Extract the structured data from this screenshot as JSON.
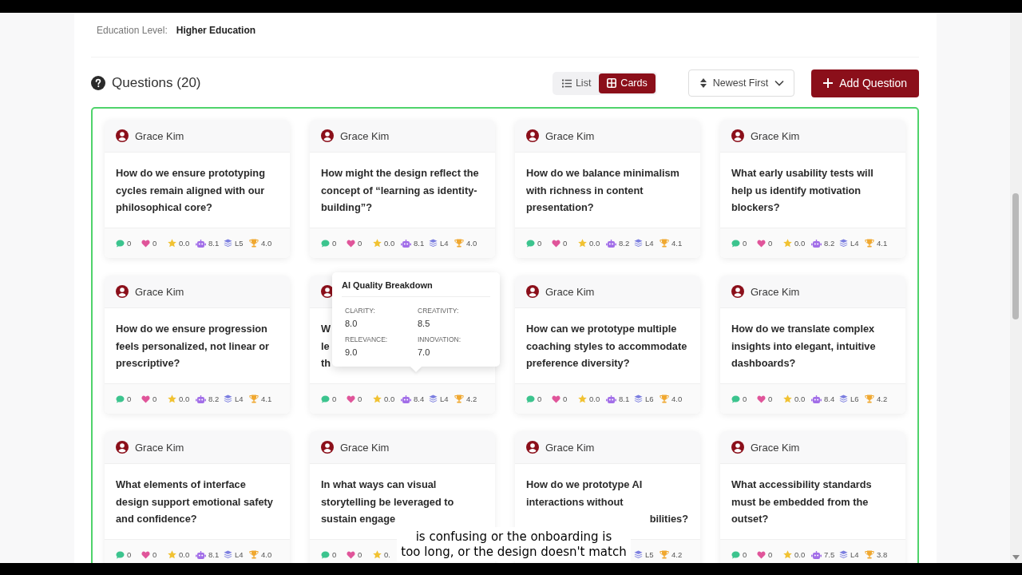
{
  "education": {
    "label": "Education Level:",
    "value": "Higher Education"
  },
  "questions_header": {
    "title": "Questions (20)"
  },
  "view_toggle": [
    {
      "kind": "list",
      "label": "List",
      "selected": false
    },
    {
      "kind": "cards",
      "label": "Cards",
      "selected": true
    }
  ],
  "sort": {
    "label": "Newest First"
  },
  "add_button": {
    "label": "Add Question"
  },
  "cards": [
    {
      "author": "Grace Kim",
      "question": "How do we ensure prototyping cycles remain aligned with our philosophical core?",
      "stats": [
        {
          "kind": "comments",
          "value": "0"
        },
        {
          "kind": "likes",
          "value": "0"
        },
        {
          "kind": "rating",
          "value": "0.0"
        },
        {
          "kind": "ai",
          "value": "8.1"
        },
        {
          "kind": "level",
          "value": "L5"
        },
        {
          "kind": "score",
          "value": "4.0"
        }
      ]
    },
    {
      "author": "Grace Kim",
      "question": "How might the design reflect the concept of “learning as identity-building”?",
      "stats": [
        {
          "kind": "comments",
          "value": "0"
        },
        {
          "kind": "likes",
          "value": "0"
        },
        {
          "kind": "rating",
          "value": "0.0"
        },
        {
          "kind": "ai",
          "value": "8.1"
        },
        {
          "kind": "level",
          "value": "L4"
        },
        {
          "kind": "score",
          "value": "4.0"
        }
      ]
    },
    {
      "author": "Grace Kim",
      "question": "How do we balance minimalism with richness in content presentation?",
      "stats": [
        {
          "kind": "comments",
          "value": "0"
        },
        {
          "kind": "likes",
          "value": "0"
        },
        {
          "kind": "rating",
          "value": "0.0"
        },
        {
          "kind": "ai",
          "value": "8.2"
        },
        {
          "kind": "level",
          "value": "L4"
        },
        {
          "kind": "score",
          "value": "4.1"
        }
      ]
    },
    {
      "author": "Grace Kim",
      "question": "What early usability tests will help us identify motivation blockers?",
      "stats": [
        {
          "kind": "comments",
          "value": "0"
        },
        {
          "kind": "likes",
          "value": "0"
        },
        {
          "kind": "rating",
          "value": "0.0"
        },
        {
          "kind": "ai",
          "value": "8.2"
        },
        {
          "kind": "level",
          "value": "L4"
        },
        {
          "kind": "score",
          "value": "4.1"
        }
      ]
    },
    {
      "author": "Grace Kim",
      "question": "How do we ensure progression feels personalized, not linear or prescriptive?",
      "stats": [
        {
          "kind": "comments",
          "value": "0"
        },
        {
          "kind": "likes",
          "value": "0"
        },
        {
          "kind": "rating",
          "value": "0.0"
        },
        {
          "kind": "ai",
          "value": "8.2"
        },
        {
          "kind": "level",
          "value": "L4"
        },
        {
          "kind": "score",
          "value": "4.1"
        }
      ]
    },
    {
      "question_lines": [
        {
          "text": "W"
        },
        {
          "text": "le"
        },
        {
          "text": "th"
        }
      ],
      "tooltip": {
        "title": "AI Quality Breakdown",
        "metrics": [
          {
            "label": "CLARITY:",
            "value": "8.0"
          },
          {
            "label": "CREATIVITY:",
            "value": "8.5"
          },
          {
            "label": "RELEVANCE:",
            "value": "9.0"
          },
          {
            "label": "INNOVATION:",
            "value": "7.0"
          }
        ]
      },
      "stats": [
        {
          "kind": "comments",
          "value": "0"
        },
        {
          "kind": "likes",
          "value": "0"
        },
        {
          "kind": "rating",
          "value": "0.0"
        },
        {
          "kind": "ai",
          "value": "8.4"
        },
        {
          "kind": "level",
          "value": "L4"
        },
        {
          "kind": "score",
          "value": "4.2"
        }
      ]
    },
    {
      "author": "Grace Kim",
      "question": "How can we prototype multiple coaching styles to accommodate preference diversity?",
      "stats": [
        {
          "kind": "comments",
          "value": "0"
        },
        {
          "kind": "likes",
          "value": "0"
        },
        {
          "kind": "rating",
          "value": "0.0"
        },
        {
          "kind": "ai",
          "value": "8.1"
        },
        {
          "kind": "level",
          "value": "L6"
        },
        {
          "kind": "score",
          "value": "4.0"
        }
      ]
    },
    {
      "author": "Grace Kim",
      "question": "How do we translate complex insights into elegant, intuitive dashboards?",
      "stats": [
        {
          "kind": "comments",
          "value": "0"
        },
        {
          "kind": "likes",
          "value": "0"
        },
        {
          "kind": "rating",
          "value": "0.0"
        },
        {
          "kind": "ai",
          "value": "8.4"
        },
        {
          "kind": "level",
          "value": "L6"
        },
        {
          "kind": "score",
          "value": "4.2"
        }
      ]
    },
    {
      "author": "Grace Kim",
      "question": "What elements of interface design support emotional safety and confidence?",
      "stats": [
        {
          "kind": "comments",
          "value": "0"
        },
        {
          "kind": "likes",
          "value": "0"
        },
        {
          "kind": "rating",
          "value": "0.0"
        },
        {
          "kind": "ai",
          "value": "8.1"
        },
        {
          "kind": "level",
          "value": "L4"
        },
        {
          "kind": "score",
          "value": "4.0"
        }
      ]
    },
    {
      "author": "Grace Kim",
      "question": "In what ways can visual storytelling be leveraged to sustain engage",
      "stats": [
        {
          "kind": "comments",
          "value": "0"
        },
        {
          "kind": "likes",
          "value": "0"
        },
        {
          "kind": "rating",
          "value": "0."
        }
      ]
    },
    {
      "author": "Grace Kim",
      "question_lines": [
        {
          "text": "How do we prototype AI"
        },
        {
          "text": "interactions without"
        },
        {
          "text": "bilities?",
          "kind": "tail"
        }
      ],
      "stats": [
        {
          "kind": "level",
          "value": "L5"
        },
        {
          "kind": "score",
          "value": "4.2"
        }
      ]
    },
    {
      "author": "Grace Kim",
      "question": "What accessibility standards must be embedded from the outset?",
      "stats": [
        {
          "kind": "comments",
          "value": "0"
        },
        {
          "kind": "likes",
          "value": "0"
        },
        {
          "kind": "rating",
          "value": "0.0"
        },
        {
          "kind": "ai",
          "value": "7.5"
        },
        {
          "kind": "level",
          "value": "L4"
        },
        {
          "kind": "score",
          "value": "3.8"
        }
      ]
    }
  ],
  "caption": {
    "lines": [
      "is confusing or the onboarding is",
      "too long, or the design doesn't match"
    ]
  }
}
